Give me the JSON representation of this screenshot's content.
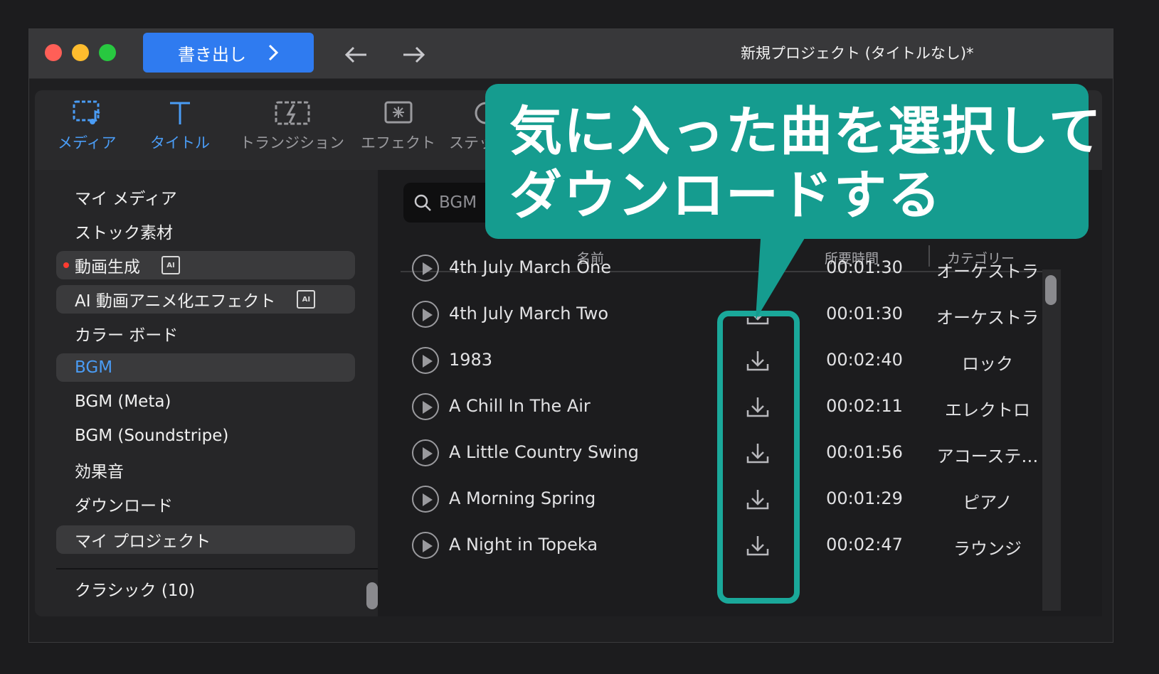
{
  "titlebar": {
    "export_label": "書き出し",
    "project_title": "新規プロジェクト (タイトルなし)*"
  },
  "tools": [
    {
      "label": "メディア",
      "icon": "media-icon",
      "active": true
    },
    {
      "label": "タイトル",
      "icon": "title-icon",
      "active": false
    },
    {
      "label": "トランジション",
      "icon": "transition-icon",
      "active": false
    },
    {
      "label": "エフェクト",
      "icon": "effect-icon",
      "active": false
    },
    {
      "label": "ステッ",
      "icon": "sticker-icon",
      "active": false
    }
  ],
  "sidebar": {
    "items": [
      {
        "label": "マイ メディア"
      },
      {
        "label": "ストック素材"
      },
      {
        "label": "動画生成"
      },
      {
        "label": "AI 動画アニメ化エフェクト"
      },
      {
        "label": "カラー ボード"
      },
      {
        "label": "BGM"
      },
      {
        "label": "BGM (Meta)"
      },
      {
        "label": "BGM (Soundstripe)"
      },
      {
        "label": "効果音"
      },
      {
        "label": "ダウンロード"
      },
      {
        "label": "マイ プロジェクト"
      }
    ],
    "ai_badge": "AI",
    "classic_label": "クラシック (10)"
  },
  "search": {
    "value": "BGM"
  },
  "table": {
    "col_name": "名前",
    "col_duration": "所要時間",
    "col_category": "カテゴリー",
    "rows": [
      {
        "name": "4th July March One",
        "duration": "00:01:30",
        "category": "オーケストラ"
      },
      {
        "name": "4th July March Two",
        "duration": "00:01:30",
        "category": "オーケストラ"
      },
      {
        "name": "1983",
        "duration": "00:02:40",
        "category": "ロック"
      },
      {
        "name": "A Chill In The Air",
        "duration": "00:02:11",
        "category": "エレクトロ"
      },
      {
        "name": "A Little Country Swing",
        "duration": "00:01:56",
        "category": "アコーステ…"
      },
      {
        "name": "A Morning Spring",
        "duration": "00:01:29",
        "category": "ピアノ"
      },
      {
        "name": "A Night in Topeka",
        "duration": "00:02:47",
        "category": "ラウンジ"
      }
    ]
  },
  "callout": {
    "line1": "気に入った曲を選択して",
    "line2": "ダウンロードする"
  },
  "colors": {
    "accent": "#2f7bf0",
    "active_tab": "#4a9cf5",
    "callout": "#159c8f"
  }
}
